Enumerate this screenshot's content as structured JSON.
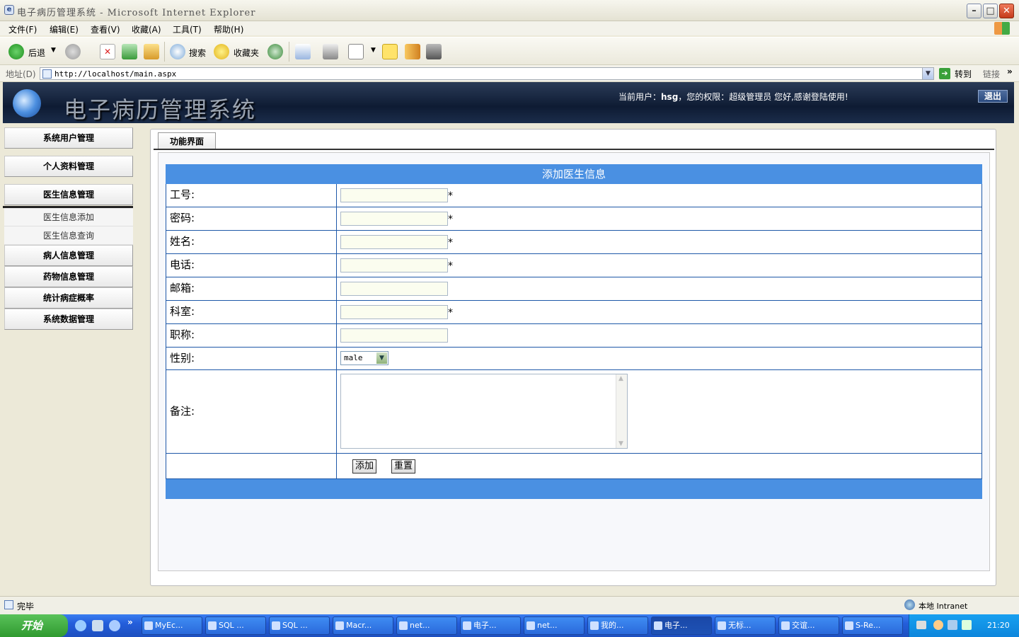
{
  "window": {
    "title": "电子病历管理系统 - Microsoft Internet Explorer"
  },
  "menu": [
    "文件(F)",
    "编辑(E)",
    "查看(V)",
    "收藏(A)",
    "工具(T)",
    "帮助(H)"
  ],
  "toolbar": {
    "back": "后退",
    "search": "搜索",
    "favorites": "收藏夹"
  },
  "address": {
    "label": "地址(D)",
    "url": "http://localhost/main.aspx",
    "go": "转到",
    "links": "链接"
  },
  "app": {
    "title": "电子病历管理系统",
    "user_prefix": "当前用户：",
    "user": "hsg",
    "role_text": "，您的权限：超级管理员  您好,感谢登陆使用!",
    "logout": "退出"
  },
  "nav": {
    "items": [
      "系统用户管理",
      "个人资料管理",
      "医生信息管理",
      "病人信息管理",
      "药物信息管理",
      "统计病症概率",
      "系统数据管理"
    ],
    "sub_items": [
      "医生信息添加",
      "医生信息查询"
    ]
  },
  "panel": {
    "tab": "功能界面"
  },
  "form": {
    "heading": "添加医生信息",
    "fields": {
      "id": "工号:",
      "password": "密码:",
      "name": "姓名:",
      "phone": "电话:",
      "email": "邮箱:",
      "department": "科室:",
      "title": "职称:",
      "gender": "性别:",
      "remarks": "备注:"
    },
    "required_mark": "*",
    "gender_value": "male",
    "add_button": "添加",
    "reset_button": "重置"
  },
  "status": {
    "text": "完毕",
    "zone": "本地 Intranet"
  },
  "taskbar": {
    "start": "开始",
    "tasks": [
      "MyEc...",
      "SQL ...",
      "SQL ...",
      "Macr...",
      "net...",
      "电子...",
      "net...",
      "我的...",
      "电子...",
      "无标...",
      "交谊...",
      "S-Re..."
    ],
    "clock": "21:20"
  }
}
